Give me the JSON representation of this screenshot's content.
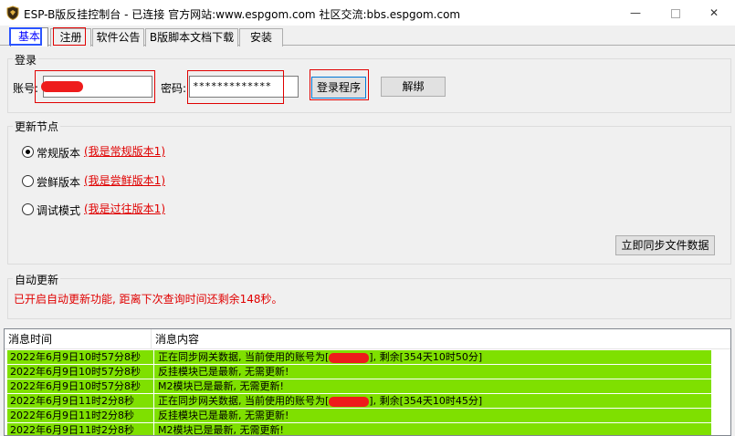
{
  "window": {
    "title": "ESP-B版反挂控制台 - 已连接    官方网站:www.espgom.com 社区交流:bbs.espgom.com",
    "minimize_glyph": "—",
    "close_glyph": "✕"
  },
  "tabs": [
    {
      "label": "基本",
      "active": true
    },
    {
      "label": "注册",
      "active": false
    },
    {
      "label": "软件公告",
      "active": false
    },
    {
      "label": "B版脚本文档下载",
      "active": false
    },
    {
      "label": "安装",
      "active": false
    }
  ],
  "login": {
    "group_title": "登录",
    "account_label": "账号:",
    "account_value": "",
    "password_label": "密码:",
    "password_value": "*************",
    "login_button": "登录程序",
    "unbind_button": "解绑"
  },
  "update_nodes": {
    "group_title": "更新节点",
    "options": [
      {
        "label": "常规版本",
        "link": "(我是常规版本1)",
        "selected": true
      },
      {
        "label": "尝鲜版本",
        "link": "(我是尝鲜版本1)",
        "selected": false
      },
      {
        "label": "调试模式",
        "link": "(我是过往版本1)",
        "selected": false
      }
    ],
    "sync_button": "立即同步文件数据"
  },
  "auto_update": {
    "group_title": "自动更新",
    "status_text": "已开启自动更新功能, 距离下次查询时间还剩余148秒。"
  },
  "log": {
    "columns": [
      "消息时间",
      "消息内容"
    ],
    "row_color": "#7fe000",
    "rows": [
      {
        "time": "2022年6月9日10时57分8秒",
        "content_prefix": "正在同步网关数据, 当前使用的账号为[",
        "redacted": true,
        "content_suffix": "], 剩余[354天10时50分]"
      },
      {
        "time": "2022年6月9日10时57分8秒",
        "content_prefix": "反挂模块已是最新, 无需更新!",
        "redacted": false,
        "content_suffix": ""
      },
      {
        "time": "2022年6月9日10时57分8秒",
        "content_prefix": "M2模块已是最新, 无需更新!",
        "redacted": false,
        "content_suffix": ""
      },
      {
        "time": "2022年6月9日11时2分8秒",
        "content_prefix": "正在同步网关数据, 当前使用的账号为[",
        "redacted": true,
        "content_suffix": "], 剩余[354天10时45分]"
      },
      {
        "time": "2022年6月9日11时2分8秒",
        "content_prefix": "反挂模块已是最新, 无需更新!",
        "redacted": false,
        "content_suffix": ""
      },
      {
        "time": "2022年6月9日11时2分8秒",
        "content_prefix": "M2模块已是最新, 无需更新!",
        "redacted": false,
        "content_suffix": ""
      }
    ]
  },
  "colors": {
    "highlight_red": "#e00000",
    "tab_highlight_blue": "#2b54ff",
    "redaction": "#ee1b1b"
  }
}
